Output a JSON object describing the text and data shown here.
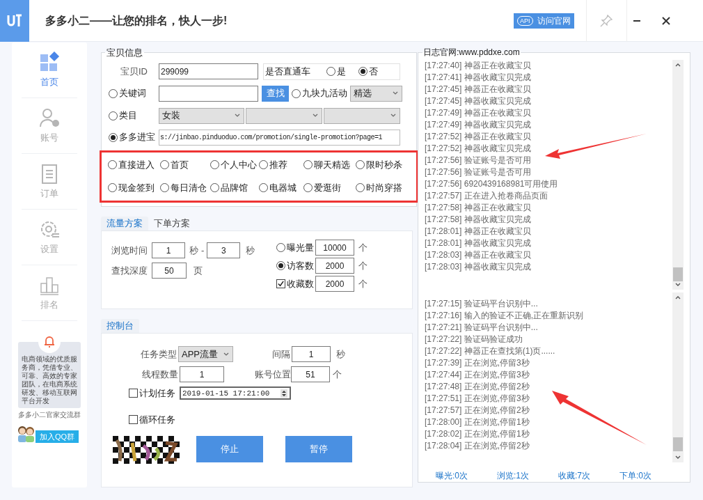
{
  "window": {
    "title": "多多小二——让您的排名，快人一步!",
    "api_badge": "API",
    "visit_button": "访问官网"
  },
  "sidebar": {
    "items": [
      {
        "label": "首页",
        "selected": true
      },
      {
        "label": "账号",
        "selected": false
      },
      {
        "label": "订单",
        "selected": false
      },
      {
        "label": "设置",
        "selected": false
      },
      {
        "label": "排名",
        "selected": false
      }
    ],
    "notice": "电商领域的优质服务商，凭借专业、可靠、高效的专家团队，在电商系统研发、移动互联网平台开发",
    "qq_banner": {
      "caption": "多多小二官家交流群",
      "button": "加入QQ群"
    }
  },
  "item_info": {
    "title": "宝贝信息",
    "id_label": "宝贝ID",
    "id_value": "299099",
    "through_train": {
      "label": "是否直通车",
      "options": [
        {
          "label": "是",
          "selected": false
        },
        {
          "label": "否",
          "selected": true
        }
      ]
    },
    "keyword": {
      "label": "关键词",
      "selected": false,
      "button": "查找"
    },
    "nine_activity": {
      "label": "九块九活动",
      "selected": false,
      "dropdown": "精选"
    },
    "category": {
      "label": "类目",
      "selected": false,
      "dropdowns": [
        "女装"
      ]
    },
    "duoduo": {
      "label": "多多进宝",
      "selected": true,
      "url": "s://jinbao.pinduoduo.com/promotion/single-promotion?page=1"
    },
    "entries": [
      {
        "label": "直接进入",
        "selected": false
      },
      {
        "label": "首页",
        "selected": false
      },
      {
        "label": "个人中心",
        "selected": false
      },
      {
        "label": "推荐",
        "selected": false
      },
      {
        "label": "聊天精选",
        "selected": false
      },
      {
        "label": "限时秒杀",
        "selected": false
      },
      {
        "label": "现金签到",
        "selected": false
      },
      {
        "label": "每日清仓",
        "selected": false
      },
      {
        "label": "品牌馆",
        "selected": false
      },
      {
        "label": "电器城",
        "selected": false
      },
      {
        "label": "爱逛街",
        "selected": false
      },
      {
        "label": "时尚穿搭",
        "selected": false
      }
    ]
  },
  "plan_tabs": [
    {
      "label": "流量方案",
      "selected": true
    },
    {
      "label": "下单方案",
      "selected": false
    }
  ],
  "traffic": {
    "browse_time": {
      "label": "浏览时间",
      "from": "1",
      "unit": "秒",
      "dash": "-",
      "to": "3",
      "unit2": "秒"
    },
    "search_depth": {
      "label": "查找深度",
      "value": "50",
      "unit": "页"
    },
    "targets": [
      {
        "kind": "radio",
        "label": "曝光量",
        "checked": false,
        "value": "10000",
        "unit": "个"
      },
      {
        "kind": "radio",
        "label": "访客数",
        "checked": true,
        "value": "2000",
        "unit": "个"
      },
      {
        "kind": "checkbox",
        "label": "收藏数",
        "checked": true,
        "value": "2000",
        "unit": "个"
      }
    ]
  },
  "console_tabs": [
    {
      "label": "控制台",
      "selected": true
    }
  ],
  "console": {
    "task_type": {
      "label": "任务类型",
      "value": "APP流量"
    },
    "interval": {
      "label": "间隔",
      "value": "1",
      "unit": "秒"
    },
    "threads": {
      "label": "线程数量",
      "value": "1"
    },
    "account_position": {
      "label": "账号位置",
      "value": "51",
      "unit": "个"
    },
    "scheduled": {
      "label": "计划任务",
      "checked": false,
      "datetime": "2019-01-15 17:21:00"
    },
    "loop": {
      "label": "循环任务",
      "checked": false
    },
    "buttons": [
      "停止",
      "暂停"
    ]
  },
  "log": {
    "title": "日志官网:www.pddxe.com",
    "upper_lines": [
      "[17:27:40] 神器正在收藏宝贝",
      "[17:27:41] 神器收藏宝贝完成",
      "[17:27:45] 神器正在收藏宝贝",
      "[17:27:45] 神器收藏宝贝完成",
      "[17:27:49] 神器正在收藏宝贝",
      "[17:27:49] 神器收藏宝贝完成",
      "[17:27:52] 神器正在收藏宝贝",
      "[17:27:52] 神器收藏宝贝完成",
      "[17:27:56] 验证账号是否可用",
      "[17:27:56] 验证账号是否可用",
      "[17:27:56] 6920439168981可用使用",
      "[17:27:57] 正在进入抢卷商品页面",
      "[17:27:58] 神器正在收藏宝贝",
      "[17:27:58] 神器收藏宝贝完成",
      "[17:28:01] 神器正在收藏宝贝",
      "[17:28:01] 神器收藏宝贝完成",
      "[17:28:03] 神器正在收藏宝贝",
      "[17:28:03] 神器收藏宝贝完成"
    ],
    "lower_lines": [
      "[17:27:15] 验证码平台识别中...",
      "[17:27:16] 输入的验证不正确,正在重新识别",
      "[17:27:21] 验证码平台识别中...",
      "[17:27:22] 验证码验证成功",
      "[17:27:22] 神器正在查找第(1)页......",
      "[17:27:39] 正在浏览,停留3秒",
      "[17:27:44] 正在浏览,停留3秒",
      "[17:27:48] 正在浏览,停留2秒",
      "[17:27:51] 正在浏览,停留3秒",
      "[17:27:57] 正在浏览,停留2秒",
      "[17:28:00] 正在浏览,停留1秒",
      "[17:28:02] 正在浏览,停留1秒",
      "[17:28:04] 正在浏览,停留2秒"
    ],
    "stats": [
      "曝光:0次",
      "浏览:1次",
      "收藏:7次",
      "下单:0次"
    ]
  }
}
